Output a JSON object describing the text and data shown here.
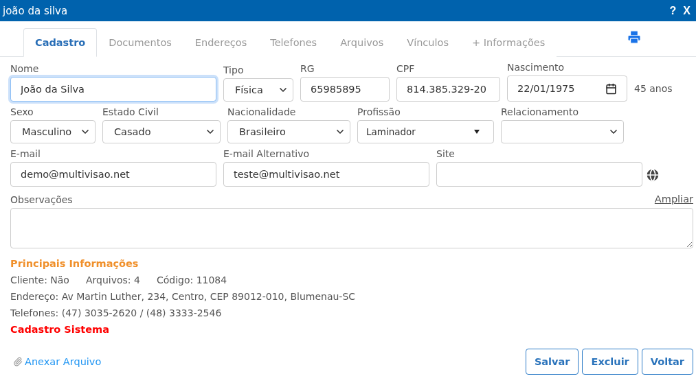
{
  "window": {
    "title": "joão da silva",
    "help": "?",
    "close": "X"
  },
  "tabs": [
    {
      "label": "Cadastro",
      "selected": true
    },
    {
      "label": "Documentos",
      "selected": false
    },
    {
      "label": "Endereços",
      "selected": false
    },
    {
      "label": "Telefones",
      "selected": false
    },
    {
      "label": "Arquivos",
      "selected": false
    },
    {
      "label": "Vínculos",
      "selected": false
    },
    {
      "label": "+ Informações",
      "selected": false
    }
  ],
  "rows": [
    {
      "fields": [
        {
          "label": "Nome",
          "kind": "text",
          "value": "João da Silva",
          "focused": true
        },
        {
          "label": "Tipo",
          "kind": "select",
          "value": "Física"
        },
        {
          "label": "RG",
          "kind": "text",
          "value": "65985895"
        },
        {
          "label": "CPF",
          "kind": "text",
          "value": "814.385.329-20"
        },
        {
          "label": "Nascimento",
          "kind": "date",
          "value": "22/01/1975"
        }
      ],
      "note": "45 anos"
    },
    {
      "fields": [
        {
          "label": "Sexo",
          "kind": "select",
          "value": "Masculino"
        },
        {
          "label": "Estado Civil",
          "kind": "select",
          "value": "Casado"
        },
        {
          "label": "Nacionalidade",
          "kind": "select",
          "value": "Brasileiro"
        },
        {
          "label": "Profissão",
          "kind": "dropdown",
          "value": "Laminador"
        },
        {
          "label": "Relacionamento",
          "kind": "select"
        }
      ]
    },
    {
      "fields": [
        {
          "label": "E-mail",
          "kind": "text",
          "value": "demo@multivisao.net"
        },
        {
          "label": "E-mail Alternativo",
          "kind": "text",
          "value": "teste@multivisao.net"
        },
        {
          "label": "Site",
          "kind": "text"
        }
      ],
      "globe": true
    }
  ],
  "observations": {
    "label": "Observações",
    "link": "Ampliar"
  },
  "summary": {
    "title": "Principais Informações",
    "facts": [
      "Cliente: Não",
      "Arquivos: 4",
      "Código: 11084"
    ],
    "lines": [
      "Endereço: Av Martin Luther, 234, Centro, CEP 89012-010, Blumenau-SC",
      "Telefones: (47) 3035-2620 / (48) 3333-2546"
    ],
    "alert": "Cadastro Sistema"
  },
  "attach": "Anexar Arquivo",
  "buttons": [
    "Salvar",
    "Excluir",
    "Voltar"
  ]
}
